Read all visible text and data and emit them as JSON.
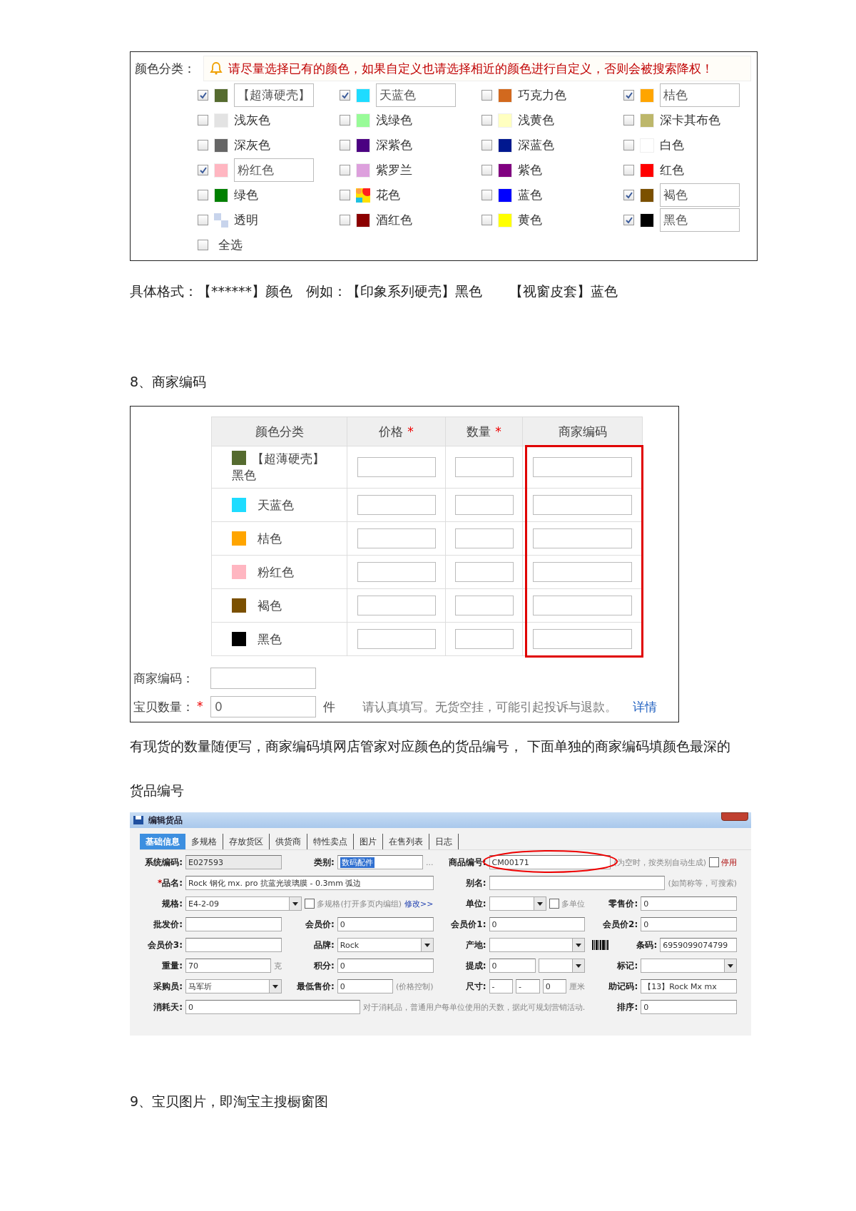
{
  "color_panel": {
    "label": "颜色分类：",
    "notice": "请尽量选择已有的颜色，如果自定义也请选择相近的颜色进行自定义，否则会被搜索降权！",
    "options": [
      {
        "name": "【超薄硬壳】",
        "kind": "solid",
        "color": "#556b2f",
        "checked": true
      },
      {
        "name": "天蓝色",
        "kind": "solid",
        "color": "#1edcff",
        "checked": true
      },
      {
        "name": "巧克力色",
        "kind": "solid",
        "color": "#d2691e",
        "checked": false
      },
      {
        "name": "桔色",
        "kind": "solid",
        "color": "#ffa500",
        "checked": true
      },
      {
        "name": "浅灰色",
        "kind": "solid",
        "color": "#e3e3e3",
        "checked": false
      },
      {
        "name": "浅绿色",
        "kind": "solid",
        "color": "#98fb98",
        "checked": false
      },
      {
        "name": "浅黄色",
        "kind": "solid",
        "color": "#ffffc0",
        "checked": false
      },
      {
        "name": "深卡其布色",
        "kind": "solid",
        "color": "#bdb76b",
        "checked": false
      },
      {
        "name": "深灰色",
        "kind": "solid",
        "color": "#666666",
        "checked": false
      },
      {
        "name": "深紫色",
        "kind": "solid",
        "color": "#4b0082",
        "checked": false
      },
      {
        "name": "深蓝色",
        "kind": "solid",
        "color": "#00188f",
        "checked": false
      },
      {
        "name": "白色",
        "kind": "solid",
        "color": "#ffffff",
        "checked": false
      },
      {
        "name": "粉红色",
        "kind": "solid",
        "color": "#ffb6c1",
        "checked": true
      },
      {
        "name": "紫罗兰",
        "kind": "solid",
        "color": "#dda0dd",
        "checked": false
      },
      {
        "name": "紫色",
        "kind": "solid",
        "color": "#800080",
        "checked": false
      },
      {
        "name": "红色",
        "kind": "solid",
        "color": "#ff0000",
        "checked": false
      },
      {
        "name": "绿色",
        "kind": "solid",
        "color": "#008000",
        "checked": false
      },
      {
        "name": "花色",
        "kind": "multi",
        "checked": false
      },
      {
        "name": "蓝色",
        "kind": "solid",
        "color": "#0000ff",
        "checked": false
      },
      {
        "name": "褐色",
        "kind": "solid",
        "color": "#7b5000",
        "checked": true
      },
      {
        "name": "透明",
        "kind": "transparent",
        "checked": false
      },
      {
        "name": "酒红色",
        "kind": "solid",
        "color": "#8b0000",
        "checked": false
      },
      {
        "name": "黄色",
        "kind": "solid",
        "color": "#ffff00",
        "checked": false
      },
      {
        "name": "黑色",
        "kind": "solid",
        "color": "#000000",
        "checked": true
      }
    ],
    "select_all": {
      "label": "全选",
      "checked": false
    }
  },
  "format_note": "具体格式：【******】颜色　例如：【印象系列硬壳】黑色　　【视窗皮套】蓝色",
  "section_8": "8、商家编码",
  "sku_table": {
    "columns": [
      {
        "label": "颜色分类",
        "highlighted": false
      },
      {
        "label": "价格",
        "required_mark": "*",
        "highlighted": false
      },
      {
        "label": "数量",
        "required_mark": "*",
        "highlighted": false
      },
      {
        "label": "商家编码",
        "highlighted": true
      }
    ],
    "rows": [
      {
        "name": "【超薄硬壳】黑色",
        "color": "#556b2f"
      },
      {
        "name": "天蓝色",
        "color": "#1edcff"
      },
      {
        "name": "桔色",
        "color": "#ffa500"
      },
      {
        "name": "粉红色",
        "color": "#ffb6c1"
      },
      {
        "name": "褐色",
        "color": "#7b5000"
      },
      {
        "name": "黑色",
        "color": "#000000"
      }
    ],
    "merchant_code": {
      "label": "商家编码："
    },
    "quantity": {
      "label": "宝贝数量：",
      "required_mark": "*",
      "value": "0",
      "unit": "件",
      "hint": "请认真填写。无货空挂，可能引起投诉与退款。",
      "link": "详情"
    }
  },
  "paragraph": "有现货的数量随便写，商家编码填网店管家对应颜色的货品编号， 下面单独的商家编码填颜色最深的货品编号",
  "app_window": {
    "title": "编辑货品",
    "tabs": [
      {
        "label": "基础信息",
        "selected": true
      },
      {
        "label": "多规格",
        "selected": false
      },
      {
        "label": "存放货区",
        "selected": false
      },
      {
        "label": "供货商",
        "selected": false
      },
      {
        "label": "特性卖点",
        "selected": false
      },
      {
        "label": "图片",
        "selected": false
      },
      {
        "label": "在售列表",
        "selected": false
      },
      {
        "label": "日志",
        "selected": false
      }
    ],
    "rows": [
      [
        {
          "items": [
            {
              "kind": "field",
              "label": "系统编码:",
              "value": "E027593",
              "readonly": true
            }
          ]
        },
        {
          "items": [
            {
              "kind": "field",
              "label": "类别:",
              "value": "数码配件",
              "highlighted": true
            },
            {
              "kind": "unit",
              "text": "..."
            }
          ]
        },
        {
          "items": [
            {
              "kind": "field",
              "label": "商品编号:",
              "value": "CM00171",
              "circled": true
            },
            {
              "kind": "note",
              "text": "(为空时，按类别自动生成)"
            },
            {
              "kind": "check",
              "label": "停用",
              "checked": false
            }
          ]
        }
      ],
      [
        {
          "items": [
            {
              "kind": "field",
              "label": "品名:",
              "required_mark": "*",
              "value": "Rock 钢化 mx. pro 抗蓝光玻璃膜 - 0.3mm 弧边"
            }
          ]
        },
        {
          "items": [
            {
              "kind": "field",
              "label": "别名:",
              "value": ""
            },
            {
              "kind": "note",
              "text": "(如简称等，可搜索)"
            }
          ]
        }
      ],
      [
        {
          "items": [
            {
              "kind": "select",
              "label": "规格:",
              "value": "E4-2-09"
            },
            {
              "kind": "check",
              "label": "多规格(打开多页内编组)",
              "checked": false
            },
            {
              "kind": "link",
              "text": "修改>>"
            }
          ]
        },
        {
          "items": [
            {
              "kind": "select",
              "label": "单位:",
              "value": ""
            },
            {
              "kind": "check",
              "label": "多单位",
              "checked": false
            }
          ]
        },
        {
          "items": [
            {
              "kind": "field",
              "label": "零售价:",
              "value": "0"
            }
          ]
        }
      ],
      [
        {
          "items": [
            {
              "kind": "field",
              "label": "批发价:",
              "value": ""
            }
          ]
        },
        {
          "items": [
            {
              "kind": "field",
              "label": "会员价:",
              "value": "0"
            }
          ]
        },
        {
          "items": [
            {
              "kind": "field",
              "label": "会员价1:",
              "value": "0"
            }
          ]
        },
        {
          "items": [
            {
              "kind": "field",
              "label": "会员价2:",
              "value": "0"
            }
          ]
        }
      ],
      [
        {
          "items": [
            {
              "kind": "field",
              "label": "会员价3:",
              "value": ""
            }
          ]
        },
        {
          "items": [
            {
              "kind": "select",
              "label": "品牌:",
              "value": "Rock"
            }
          ]
        },
        {
          "items": [
            {
              "kind": "select",
              "label": "产地:",
              "value": ""
            }
          ]
        },
        {
          "items": [
            {
              "kind": "barcode"
            },
            {
              "kind": "field",
              "label": "条码:",
              "value": "6959099074799"
            }
          ]
        }
      ],
      [
        {
          "items": [
            {
              "kind": "field",
              "label": "重量:",
              "value": "70"
            },
            {
              "kind": "unit",
              "text": "克"
            }
          ]
        },
        {
          "items": [
            {
              "kind": "field",
              "label": "积分:",
              "value": "0"
            }
          ]
        },
        {
          "items": [
            {
              "kind": "field",
              "label": "提成:",
              "value": "0"
            },
            {
              "kind": "select",
              "value": ""
            }
          ]
        },
        {
          "items": [
            {
              "kind": "select",
              "label": "标记:",
              "value": ""
            }
          ]
        }
      ],
      [
        {
          "items": [
            {
              "kind": "select",
              "label": "采购员:",
              "value": "马军圻"
            }
          ]
        },
        {
          "items": [
            {
              "kind": "field",
              "label": "最低售价:",
              "value": "0"
            },
            {
              "kind": "note",
              "text": "(价格控制)"
            }
          ]
        },
        {
          "items": [
            {
              "kind": "field",
              "label": "尺寸:",
              "value": "-"
            },
            {
              "kind": "field",
              "value": "-"
            },
            {
              "kind": "field",
              "value": "0"
            },
            {
              "kind": "unit",
              "text": "厘米"
            }
          ]
        },
        {
          "items": [
            {
              "kind": "field",
              "label": "助记码:",
              "value": "【13】Rock Mx mx"
            }
          ]
        }
      ],
      [
        {
          "items": [
            {
              "kind": "field",
              "label": "消耗天:",
              "value": "0"
            },
            {
              "kind": "note",
              "text": "对于消耗品，普通用户每单位使用的天数，据此可规划营销活动."
            }
          ]
        },
        {
          "items": [
            {
              "kind": "field",
              "label": "排序:",
              "value": "0"
            }
          ]
        }
      ]
    ]
  },
  "section_9": "9、宝贝图片，即淘宝主搜橱窗图"
}
